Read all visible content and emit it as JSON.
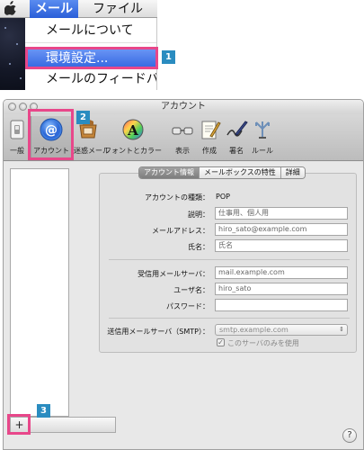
{
  "menubar": {
    "app_menu": "メール",
    "file_menu": "ファイル"
  },
  "dropdown": {
    "items": [
      {
        "label": "メールについて"
      },
      {
        "label": "環境設定..."
      },
      {
        "label": "メールのフィードバ"
      }
    ]
  },
  "steps": [
    "1",
    "2",
    "3"
  ],
  "window": {
    "title": "アカウント",
    "toolbar": [
      {
        "label": "一般",
        "icon": "switch-icon"
      },
      {
        "label": "アカウント",
        "icon": "at-sign-icon"
      },
      {
        "label": "迷惑メール",
        "icon": "junk-mail-icon"
      },
      {
        "label": "フォントとカラー",
        "icon": "font-color-icon"
      },
      {
        "label": "表示",
        "icon": "glasses-icon"
      },
      {
        "label": "作成",
        "icon": "compose-icon"
      },
      {
        "label": "署名",
        "icon": "signature-icon"
      },
      {
        "label": "ルール",
        "icon": "rules-icon"
      }
    ],
    "tabs": [
      "アカウント情報",
      "メールボックスの特性",
      "詳細"
    ],
    "form": {
      "account_type_label": "アカウントの種類：",
      "account_type_value": "POP",
      "description_label": "説明：",
      "description_placeholder": "仕事用、個人用",
      "email_label": "メールアドレス：",
      "email_placeholder": "hiro_sato@example.com",
      "name_label": "氏名：",
      "name_placeholder": "氏名",
      "incoming_server_label": "受信用メールサーバ：",
      "incoming_server_placeholder": "mail.example.com",
      "username_label": "ユーザ名：",
      "username_placeholder": "hiro_sato",
      "password_label": "パスワード：",
      "password_placeholder": "",
      "smtp_label": "送信用メールサーバ（SMTP）：",
      "smtp_value": "smtp.example.com",
      "smtp_only_label": "このサーバのみを使用"
    },
    "add_button": "+",
    "help_button": "?"
  }
}
